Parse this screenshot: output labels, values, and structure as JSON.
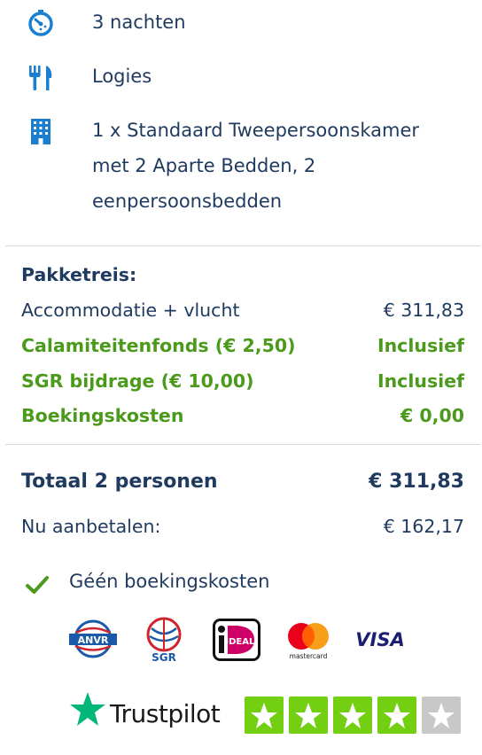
{
  "details": {
    "nights": "3 nachten",
    "board": "Logies",
    "room_lines": [
      "1 x Standaard Tweepersoonskamer",
      "met 2 Aparte Bedden, 2",
      "eenpersoonsbedden"
    ]
  },
  "package": {
    "heading": "Pakketreis:",
    "lines": [
      {
        "label": "Accommodatie + vlucht",
        "value": "€ 311,83"
      },
      {
        "label": "Calamiteitenfonds (€ 2,50)",
        "value": "Inclusief"
      },
      {
        "label": "SGR bijdrage (€ 10,00)",
        "value": "Inclusief"
      },
      {
        "label": "Boekingskosten",
        "value": "€ 0,00"
      }
    ]
  },
  "totals": {
    "total_label": "Totaal 2 personen",
    "total_value": "€ 311,83",
    "deposit_label": "Nu aanbetalen:",
    "deposit_value": "€ 162,17"
  },
  "benefit": {
    "text": "Géén boekingskosten"
  },
  "logos": {
    "anvr": "ANVR",
    "sgr": "SGR",
    "ideal": "iDEAL",
    "mastercard": "mastercard",
    "visa": "VISA"
  },
  "trustpilot": {
    "name": "Trustpilot",
    "rating_stars": 4,
    "max_stars": 5
  },
  "colors": {
    "navy": "#1f3a5f",
    "accent_blue": "#1a7fd0",
    "green": "#4b9a1c",
    "trustpilot_green": "#73cf11"
  }
}
